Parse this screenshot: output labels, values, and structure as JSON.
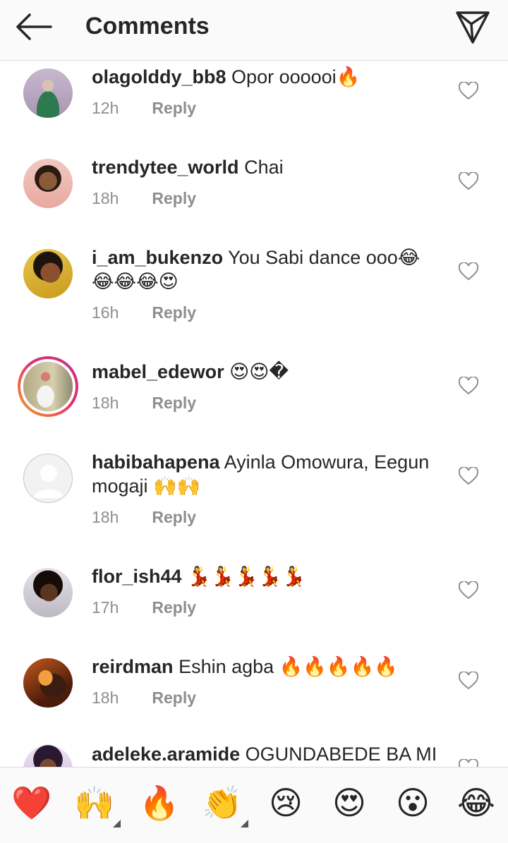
{
  "header": {
    "title": "Comments"
  },
  "comments": [
    {
      "username": "olagolddy_bb8",
      "text": "Opor oooooi🔥",
      "time": "12h",
      "reply": "Reply"
    },
    {
      "username": "trendytee_world",
      "text": "Chai",
      "time": "18h",
      "reply": "Reply"
    },
    {
      "username": "i_am_bukenzo",
      "text": "You Sabi dance ooo😂😂😂😂😍",
      "time": "16h",
      "reply": "Reply"
    },
    {
      "username": "mabel_edewor",
      "text": "😍😍�",
      "time": "18h",
      "reply": "Reply"
    },
    {
      "username": "habibahapena",
      "text": "Ayinla Omowura, Eegun mogaji 🙌🙌",
      "time": "18h",
      "reply": "Reply"
    },
    {
      "username": "flor_ish44",
      "text": "💃💃💃💃💃",
      "time": "17h",
      "reply": "Reply"
    },
    {
      "username": "reirdman",
      "text": "Eshin agba 🔥🔥🔥🔥🔥",
      "time": "18h",
      "reply": "Reply"
    },
    {
      "username": "adeleke.aramide",
      "text": "OGUNDABEDE BA MI",
      "time": "",
      "reply": ""
    }
  ],
  "reactions": [
    "❤️",
    "🙌",
    "🔥",
    "👏",
    "😢",
    "😍",
    "😮",
    "😂"
  ],
  "colors": {
    "text": "#262626",
    "secondary": "#8e8e8e",
    "bar_bg": "#fafafa",
    "divider": "#dbdbdb",
    "story_ring_start": "#f5a623",
    "story_ring_end": "#c13584"
  },
  "icons": {
    "back": "arrow-left-icon",
    "send": "paper-plane-icon",
    "like": "heart-outline-icon"
  }
}
